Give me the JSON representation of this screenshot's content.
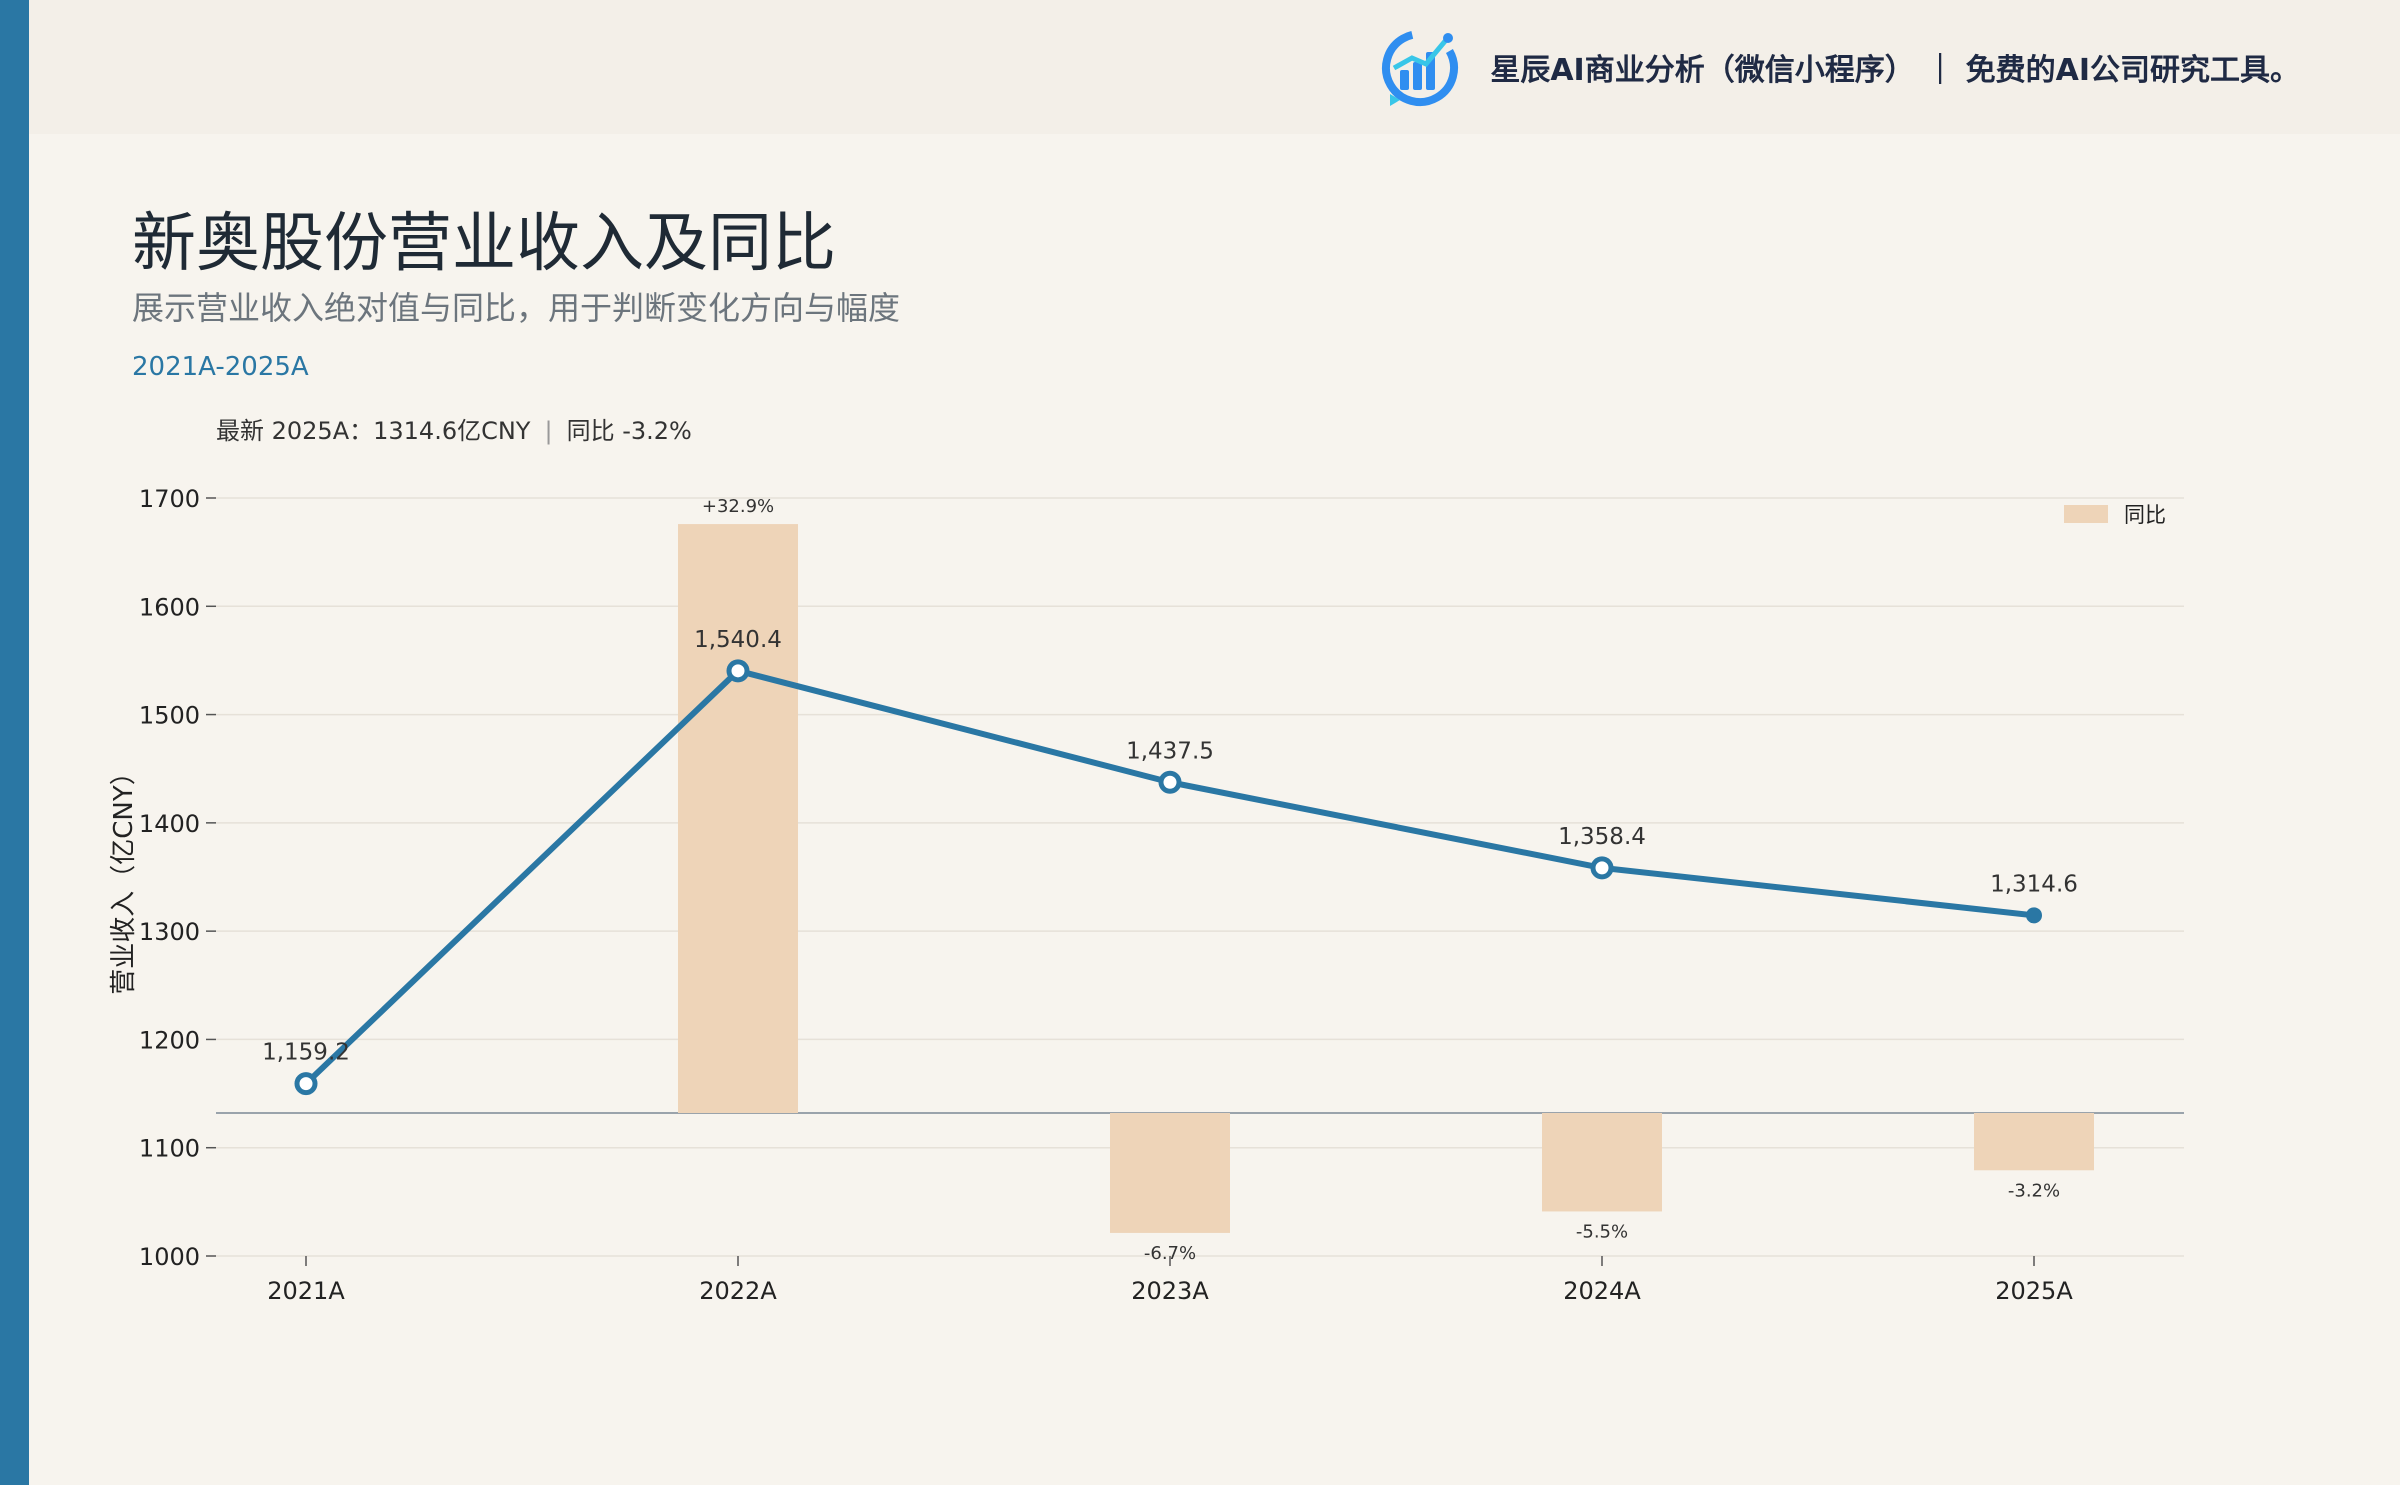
{
  "header": {
    "brand_text": "星辰AI商业分析（微信小程序） ｜ 免费的AI公司研究工具。",
    "logo_icon": "bar-chart-circle-icon"
  },
  "page": {
    "title": "新奥股份营业收入及同比",
    "subtitle": "展示营业收入绝对值与同比，用于判断变化方向与幅度",
    "range": "2021A-2025A",
    "latest_label": "最新 2025A：1314.6亿CNY",
    "latest_yoy": "同比 -3.2%",
    "latest_sep": "|"
  },
  "colors": {
    "accent": "#2a77a4",
    "bar": "#eed4b8",
    "background": "#f7f4ee"
  },
  "chart_data": {
    "type": "line",
    "categories": [
      "2021A",
      "2022A",
      "2023A",
      "2024A",
      "2025A"
    ],
    "ylabel": "营业收入（亿CNY）",
    "xlabel": "",
    "ylim": [
      1000,
      1700
    ],
    "yticks": [
      1000,
      1100,
      1200,
      1300,
      1400,
      1500,
      1600,
      1700
    ],
    "grid": true,
    "legend_position": "top-right",
    "series": [
      {
        "name": "",
        "type": "line",
        "values": [
          1159.2,
          1540.4,
          1437.5,
          1358.4,
          1314.6
        ],
        "labels": [
          "1,159.2",
          "1,540.4",
          "1,437.5",
          "1,358.4",
          "1,314.6"
        ]
      },
      {
        "name": "同比",
        "type": "bar",
        "values": [
          null,
          32.9,
          -6.7,
          -5.5,
          -3.2
        ],
        "labels": [
          "",
          "+32.9%",
          "-6.7%",
          "-5.5%",
          "-3.2%"
        ]
      }
    ]
  }
}
